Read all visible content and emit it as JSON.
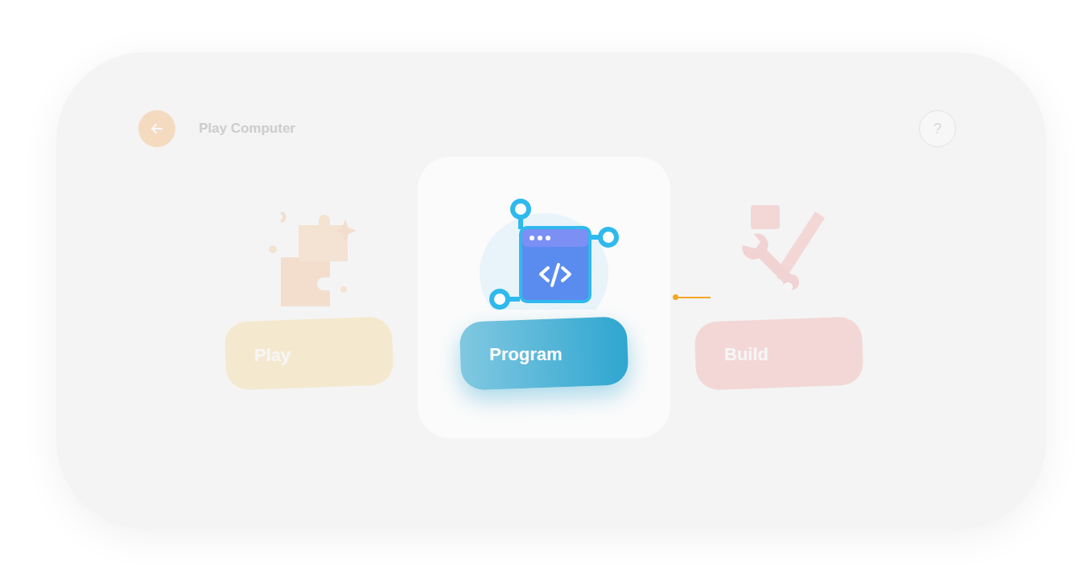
{
  "header": {
    "title": "Play Computer",
    "help": "?"
  },
  "modes": [
    {
      "label": "Play",
      "selected": false,
      "color": "#f7c23e"
    },
    {
      "label": "Program",
      "selected": true,
      "color": "#2fa6d0"
    },
    {
      "label": "Build",
      "selected": false,
      "color": "#f06a6a"
    }
  ]
}
